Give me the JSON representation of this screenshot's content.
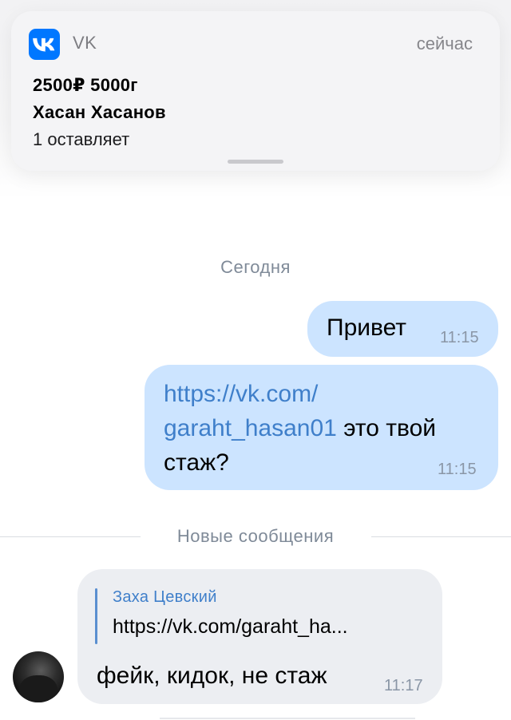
{
  "notification": {
    "app_name": "VK",
    "time": "сейчас",
    "line1": "2500₽ 5000г",
    "line2": "Хасан Хасанов",
    "line3": "1 оставляет",
    "icon": "vk-logo-icon",
    "accent_color": "#0077ff"
  },
  "chat": {
    "date_separator": "Сегодня",
    "new_messages_separator": "Новые сообщения",
    "messages": [
      {
        "direction": "outgoing",
        "text": "Привет",
        "time": "11:15"
      },
      {
        "direction": "outgoing",
        "link_line1": "https://vk.com/",
        "link_line2": "garaht_hasan01",
        "text_after_link": " это твой",
        "text_line3": "стаж?",
        "time": "11:15"
      },
      {
        "direction": "incoming",
        "reply_author": "Заха Цевский",
        "reply_text": "https://vk.com/garaht_ha...",
        "text": "фейк, кидок, не стаж",
        "time": "11:17"
      }
    ],
    "colors": {
      "outgoing_bubble": "#cce4ff",
      "incoming_bubble": "#eceef2",
      "link": "#3f7fca"
    }
  }
}
